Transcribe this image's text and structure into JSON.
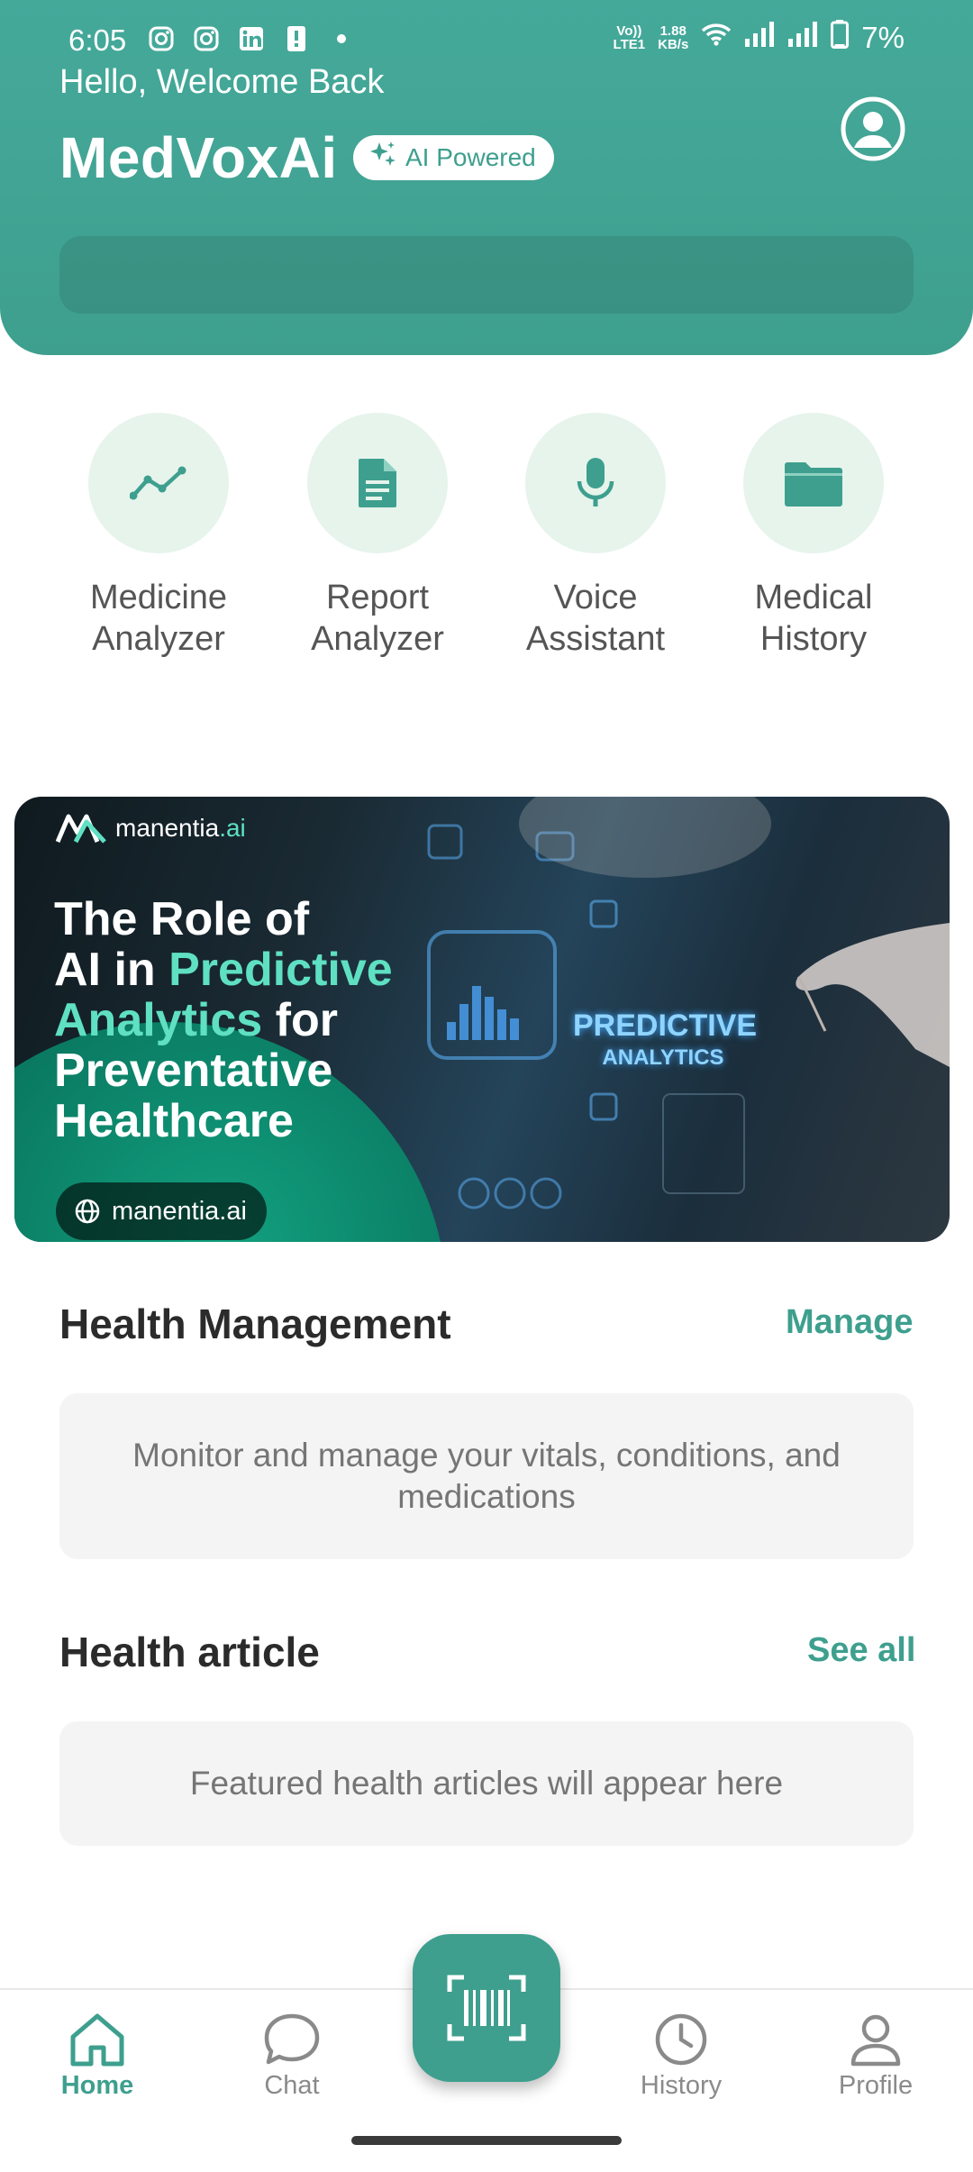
{
  "status_bar": {
    "time": "6:05",
    "network_speed_value": "1.88",
    "network_speed_unit": "KB/s",
    "volte_top": "Vo))",
    "volte_bottom": "LTE1",
    "battery": "7%"
  },
  "header": {
    "greeting": "Hello, Welcome Back",
    "app_title": "MedVoxAi",
    "badge": "AI Powered"
  },
  "quick_actions": [
    {
      "label": "Medicine\nAnalyzer",
      "icon": "trend-line-icon"
    },
    {
      "label": "Report\nAnalyzer",
      "icon": "document-icon"
    },
    {
      "label": "Voice\nAssistant",
      "icon": "microphone-icon"
    },
    {
      "label": "Medical\nHistory",
      "icon": "folder-icon"
    }
  ],
  "banner": {
    "brand": "manentia",
    "brand_suffix": ".ai",
    "headline_line1": "The Role of",
    "headline_line2a": "AI in ",
    "headline_line2b": "Predictive",
    "headline_line3a": "Analytics",
    "headline_line3b": " for",
    "headline_line4": "Preventative",
    "headline_line5": "Healthcare",
    "panel_title": "PREDICTIVE",
    "panel_subtitle": "ANALYTICS",
    "site": "manentia.ai"
  },
  "health_management": {
    "title": "Health Management",
    "action": "Manage",
    "description": "Monitor and manage your vitals, conditions, and medications"
  },
  "health_article": {
    "title": "Health article",
    "action": "See all",
    "placeholder": "Featured health articles will appear here"
  },
  "bottom_nav": {
    "home": "Home",
    "chat": "Chat",
    "history": "History",
    "profile": "Profile"
  },
  "colors": {
    "primary": "#3e9f8e",
    "icon_circle_bg": "#e6f4ec",
    "banner_accent": "#5fe0c2"
  }
}
